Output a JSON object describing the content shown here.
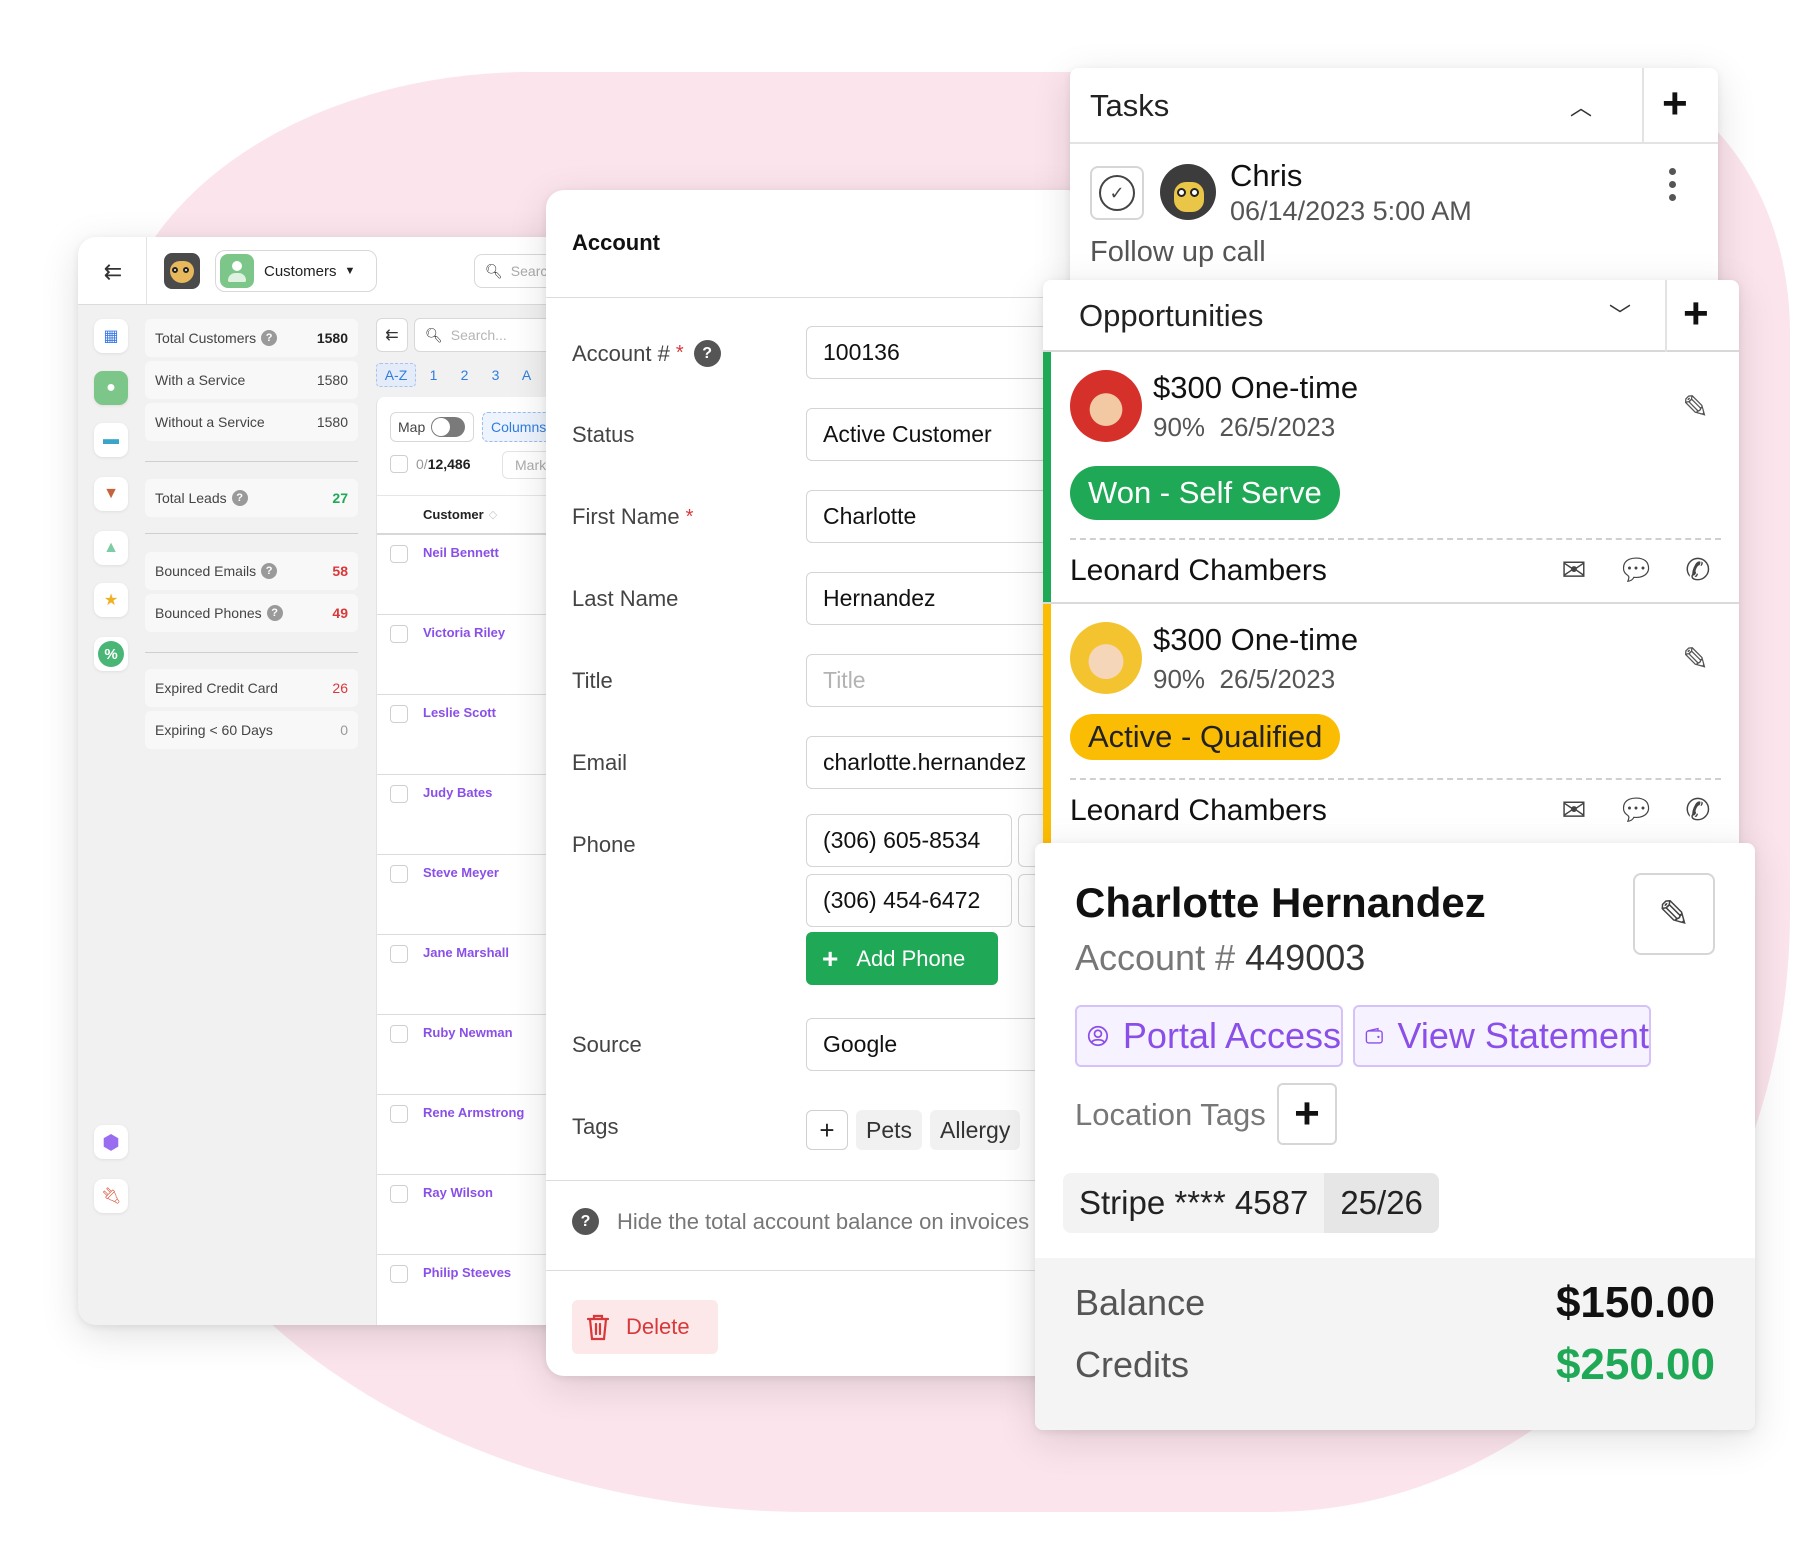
{
  "customers_panel": {
    "module_label": "Customers",
    "search_placeholder": "Search",
    "stats": [
      {
        "label": "Total Customers",
        "value": "1580",
        "has_help": true
      },
      {
        "label": "With a Service",
        "value": "1580",
        "has_help": false
      },
      {
        "label": "Without a Service",
        "value": "1580",
        "has_help": false
      },
      {
        "label": "Total Leads",
        "value": "27",
        "has_help": true
      },
      {
        "label": "Bounced Emails",
        "value": "58",
        "has_help": true
      },
      {
        "label": "Bounced Phones",
        "value": "49",
        "has_help": true
      },
      {
        "label": "Expired Credit Card",
        "value": "26",
        "has_help": false
      },
      {
        "label": "Expiring < 60 Days",
        "value": "0",
        "has_help": false
      }
    ],
    "sidebar_icons": [
      "calendar-icon",
      "customer-icon",
      "inbox-icon",
      "leads-funnel-icon",
      "marketing-icon",
      "reviews-star-icon",
      "discount-icon",
      "settings-icon",
      "integrations-plug-icon"
    ],
    "list": {
      "search_placeholder": "Search...",
      "alpha_filters": [
        "A-Z",
        "1",
        "2",
        "3",
        "A"
      ],
      "map_label": "Map",
      "columns_label": "Columns",
      "selected_count": "0",
      "total_count": "12,486",
      "mark_label": "Mark",
      "column_header": "Customer",
      "rows": [
        "Neil Bennett",
        "Victoria Riley",
        "Leslie Scott",
        "Judy Bates",
        "Steve Meyer",
        "Jane Marshall",
        "Ruby Newman",
        "Rene Armstrong",
        "Ray Wilson",
        "Philip Steeves"
      ]
    }
  },
  "account_form": {
    "title": "Account",
    "fields": {
      "account_number": {
        "label": "Account #",
        "value": "100136"
      },
      "status": {
        "label": "Status",
        "value": "Active Customer"
      },
      "first_name": {
        "label": "First Name",
        "value": "Charlotte"
      },
      "last_name": {
        "label": "Last Name",
        "value": "Hernandez"
      },
      "title": {
        "label": "Title",
        "value": "",
        "placeholder": "Title"
      },
      "email": {
        "label": "Email",
        "value": "charlotte.hernandez"
      },
      "phone": {
        "label": "Phone",
        "values": [
          "(306) 605-8534",
          "(306) 454-6472"
        ],
        "add_label": "Add Phone"
      },
      "source": {
        "label": "Source",
        "value": "Google"
      },
      "tags": {
        "label": "Tags",
        "values": [
          "Pets",
          "Allergy"
        ]
      }
    },
    "hide_balance_note": "Hide the total account balance on invoices",
    "delete_label": "Delete"
  },
  "tasks": {
    "title": "Tasks",
    "items": [
      {
        "assignee": "Chris",
        "datetime": "06/14/2023 5:00 AM",
        "description": "Follow up call"
      }
    ]
  },
  "opportunities": {
    "title": "Opportunities",
    "items": [
      {
        "amount": "$300 One-time",
        "probability": "90%",
        "date": "26/5/2023",
        "status": "Won - Self Serve",
        "status_color": "#1fa855",
        "contact": "Leonard Chambers"
      },
      {
        "amount": "$300 One-time",
        "probability": "90%",
        "date": "26/5/2023",
        "status": "Active - Qualified",
        "status_color": "#fbbc04",
        "contact": "Leonard Chambers"
      }
    ]
  },
  "customer_card": {
    "name": "Charlotte Hernandez",
    "account_label": "Account #",
    "account_number": "449003",
    "portal_access_label": "Portal Access",
    "view_statement_label": "View Statement",
    "location_tags_label": "Location Tags",
    "card_on_file": "Stripe **** 4587",
    "card_expiry": "25/26",
    "balance_label": "Balance",
    "balance_value": "$150.00",
    "credits_label": "Credits",
    "credits_value": "$250.00"
  },
  "colors": {
    "accent_purple": "#8a4fe8",
    "success_green": "#1fa855",
    "warning_yellow": "#fbbc04",
    "danger_red": "#d9383a",
    "link_blue": "#2f7de1",
    "background_blob": "#fce4ec"
  }
}
